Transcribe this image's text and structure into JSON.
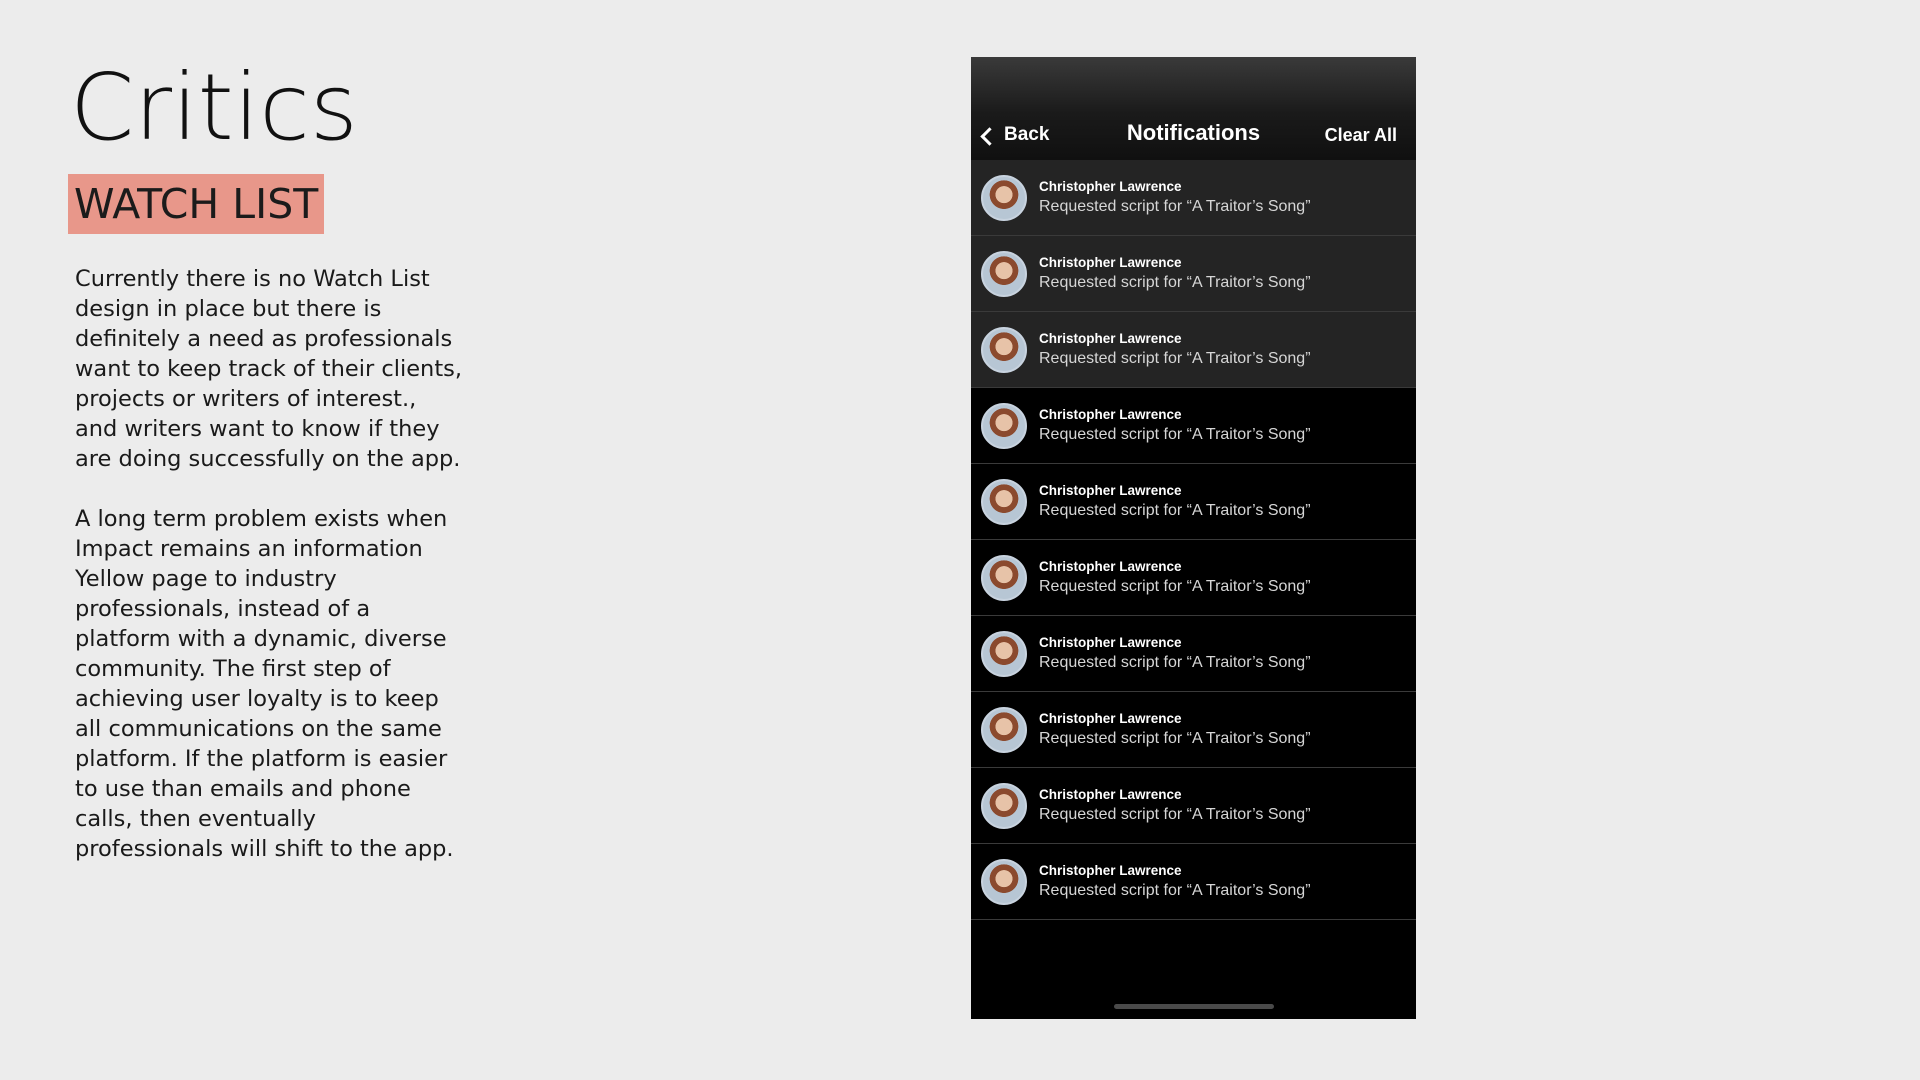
{
  "slide": {
    "title": "Critics",
    "tag": "WATCH LIST",
    "paragraphs": [
      "Currently there is no Watch List design in place but there is definitely a need as professionals want to keep track of their clients, projects or writers of interest., and writers want to know if they are doing successfully on the app.",
      "A long term problem exists when Impact remains an information Yellow page to industry professionals, instead of a platform with a dynamic, diverse community. The first step of achieving user loyalty is to keep all communications on the same platform. If the platform is easier to use than emails and phone calls, then eventually professionals will shift to the app."
    ]
  },
  "phone": {
    "back_label": "Back",
    "title": "Notifications",
    "clear_all_label": "Clear All",
    "notifications": [
      {
        "name": "Christopher Lawrence",
        "message": "Requested script for “A Traitor’s Song”",
        "highlighted": true
      },
      {
        "name": "Christopher Lawrence",
        "message": "Requested script for “A Traitor’s Song”",
        "highlighted": true
      },
      {
        "name": "Christopher Lawrence",
        "message": "Requested script for “A Traitor’s Song”",
        "highlighted": true
      },
      {
        "name": "Christopher Lawrence",
        "message": "Requested script for “A Traitor’s Song”",
        "highlighted": false
      },
      {
        "name": "Christopher Lawrence",
        "message": "Requested script for “A Traitor’s Song”",
        "highlighted": false
      },
      {
        "name": "Christopher Lawrence",
        "message": "Requested script for “A Traitor’s Song”",
        "highlighted": false
      },
      {
        "name": "Christopher Lawrence",
        "message": "Requested script for “A Traitor’s Song”",
        "highlighted": false
      },
      {
        "name": "Christopher Lawrence",
        "message": "Requested script for “A Traitor’s Song”",
        "highlighted": false
      },
      {
        "name": "Christopher Lawrence",
        "message": "Requested script for “A Traitor’s Song”",
        "highlighted": false
      },
      {
        "name": "Christopher Lawrence",
        "message": "Requested script for “A Traitor’s Song”",
        "highlighted": false
      }
    ]
  },
  "colors": {
    "background": "#ececec",
    "tag_highlight": "#e8978a",
    "phone_background": "#000000",
    "unread_row": "#242424"
  }
}
